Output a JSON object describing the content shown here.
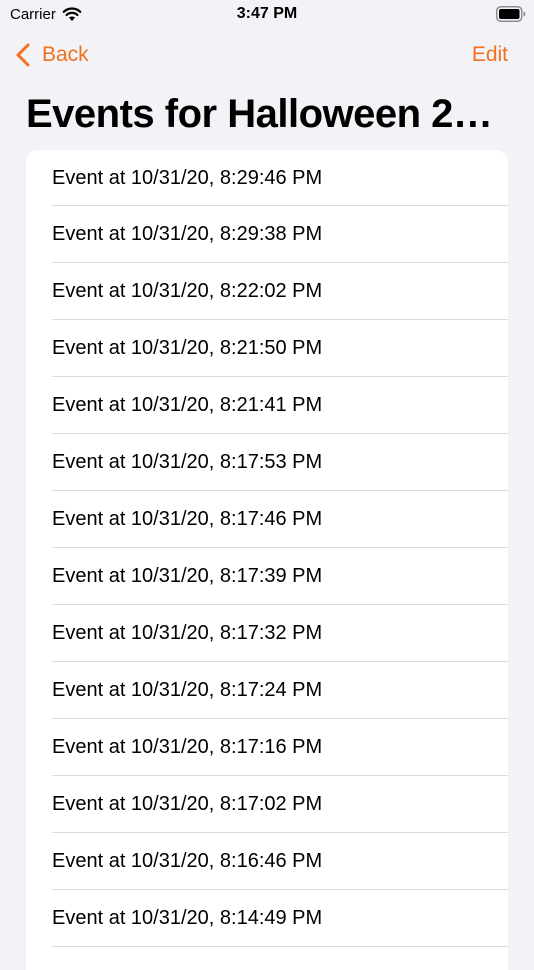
{
  "status_bar": {
    "carrier": "Carrier",
    "time": "3:47 PM"
  },
  "nav": {
    "back_label": "Back",
    "edit_label": "Edit",
    "accent_color": "#f2711c"
  },
  "title": "Events for Halloween 2…",
  "events": [
    "Event at 10/31/20, 8:29:46 PM",
    "Event at 10/31/20, 8:29:38 PM",
    "Event at 10/31/20, 8:22:02 PM",
    "Event at 10/31/20, 8:21:50 PM",
    "Event at 10/31/20, 8:21:41 PM",
    "Event at 10/31/20, 8:17:53 PM",
    "Event at 10/31/20, 8:17:46 PM",
    "Event at 10/31/20, 8:17:39 PM",
    "Event at 10/31/20, 8:17:32 PM",
    "Event at 10/31/20, 8:17:24 PM",
    "Event at 10/31/20, 8:17:16 PM",
    "Event at 10/31/20, 8:17:02 PM",
    "Event at 10/31/20, 8:16:46 PM",
    "Event at 10/31/20, 8:14:49 PM"
  ]
}
